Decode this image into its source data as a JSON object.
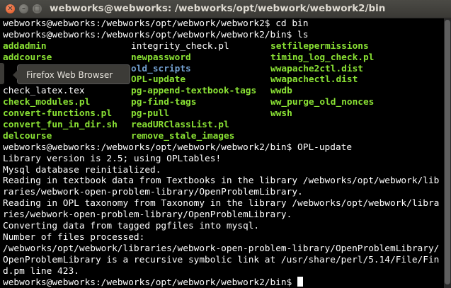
{
  "window": {
    "title": "webworks@webworks: /webworks/opt/webwork/webwork2/bin",
    "close_glyph": "✕",
    "min_glyph": "–",
    "max_glyph": "□"
  },
  "tooltip": {
    "label": "Firefox Web Browser"
  },
  "terminal": {
    "before_ls": [
      "webworks@webworks:/webworks/opt/webwork/webwork2$ cd bin",
      "webworks@webworks:/webworks/opt/webwork/webwork2/bin$ ls"
    ],
    "ls_rows": [
      [
        {
          "text": "addadmin",
          "kind": "exe"
        },
        {
          "text": "integrity_check.pl",
          "kind": "plain"
        },
        {
          "text": "setfilepermissions",
          "kind": "exe"
        }
      ],
      [
        {
          "text": "addcourse",
          "kind": "exe"
        },
        {
          "text": "newpassword",
          "kind": "exe"
        },
        {
          "text": "timing_log_check.pl",
          "kind": "exe"
        }
      ],
      [
        {
          "text": "",
          "kind": "exe"
        },
        {
          "text": "old_scripts",
          "kind": "dir"
        },
        {
          "text": "wwapache2ctl.dist",
          "kind": "exe"
        }
      ],
      [
        {
          "text": "",
          "kind": "exe"
        },
        {
          "text": "OPL-update",
          "kind": "exe"
        },
        {
          "text": "wwapachectl.dist",
          "kind": "exe"
        }
      ],
      [
        {
          "text": "check_latex.tex",
          "kind": "plain"
        },
        {
          "text": "pg-append-textbook-tags",
          "kind": "exe"
        },
        {
          "text": "wwdb",
          "kind": "exe"
        }
      ],
      [
        {
          "text": "check_modules.pl",
          "kind": "exe"
        },
        {
          "text": "pg-find-tags",
          "kind": "exe"
        },
        {
          "text": "ww_purge_old_nonces",
          "kind": "exe"
        }
      ],
      [
        {
          "text": "convert-functions.pl",
          "kind": "exe"
        },
        {
          "text": "pg-pull",
          "kind": "exe"
        },
        {
          "text": "wwsh",
          "kind": "exe"
        }
      ],
      [
        {
          "text": "convert_fun_in_dir.sh",
          "kind": "exe"
        },
        {
          "text": "readURClassList.pl",
          "kind": "exe"
        },
        {
          "text": "",
          "kind": "plain"
        }
      ],
      [
        {
          "text": "delcourse",
          "kind": "exe"
        },
        {
          "text": "remove_stale_images",
          "kind": "exe"
        },
        {
          "text": "",
          "kind": "plain"
        }
      ]
    ],
    "after_ls": [
      "webworks@webworks:/webworks/opt/webwork/webwork2/bin$ OPL-update",
      "Library version is 2.5; using OPLtables!",
      "Mysql database reinitialized.",
      "Reading in textbook data from Textbooks in the library /webworks/opt/webwork/lib",
      "raries/webwork-open-problem-library/OpenProblemLibrary.",
      "Reading in OPL taxonomy from Taxonomy in the library /webworks/opt/webwork/libra",
      "ries/webwork-open-problem-library/OpenProblemLibrary.",
      "Converting data from tagged pgfiles into mysql.",
      "Number of files processed:",
      "/webworks/opt/webwork/libraries/webwork-open-problem-library/OpenProblemLibrary/",
      "OpenProblemLibrary is a recursive symbolic link at /usr/share/perl/5.14/File/Fin",
      "d.pm line 423."
    ],
    "final_prompt": "webworks@webworks:/webworks/opt/webwork/webwork2/bin$ "
  }
}
